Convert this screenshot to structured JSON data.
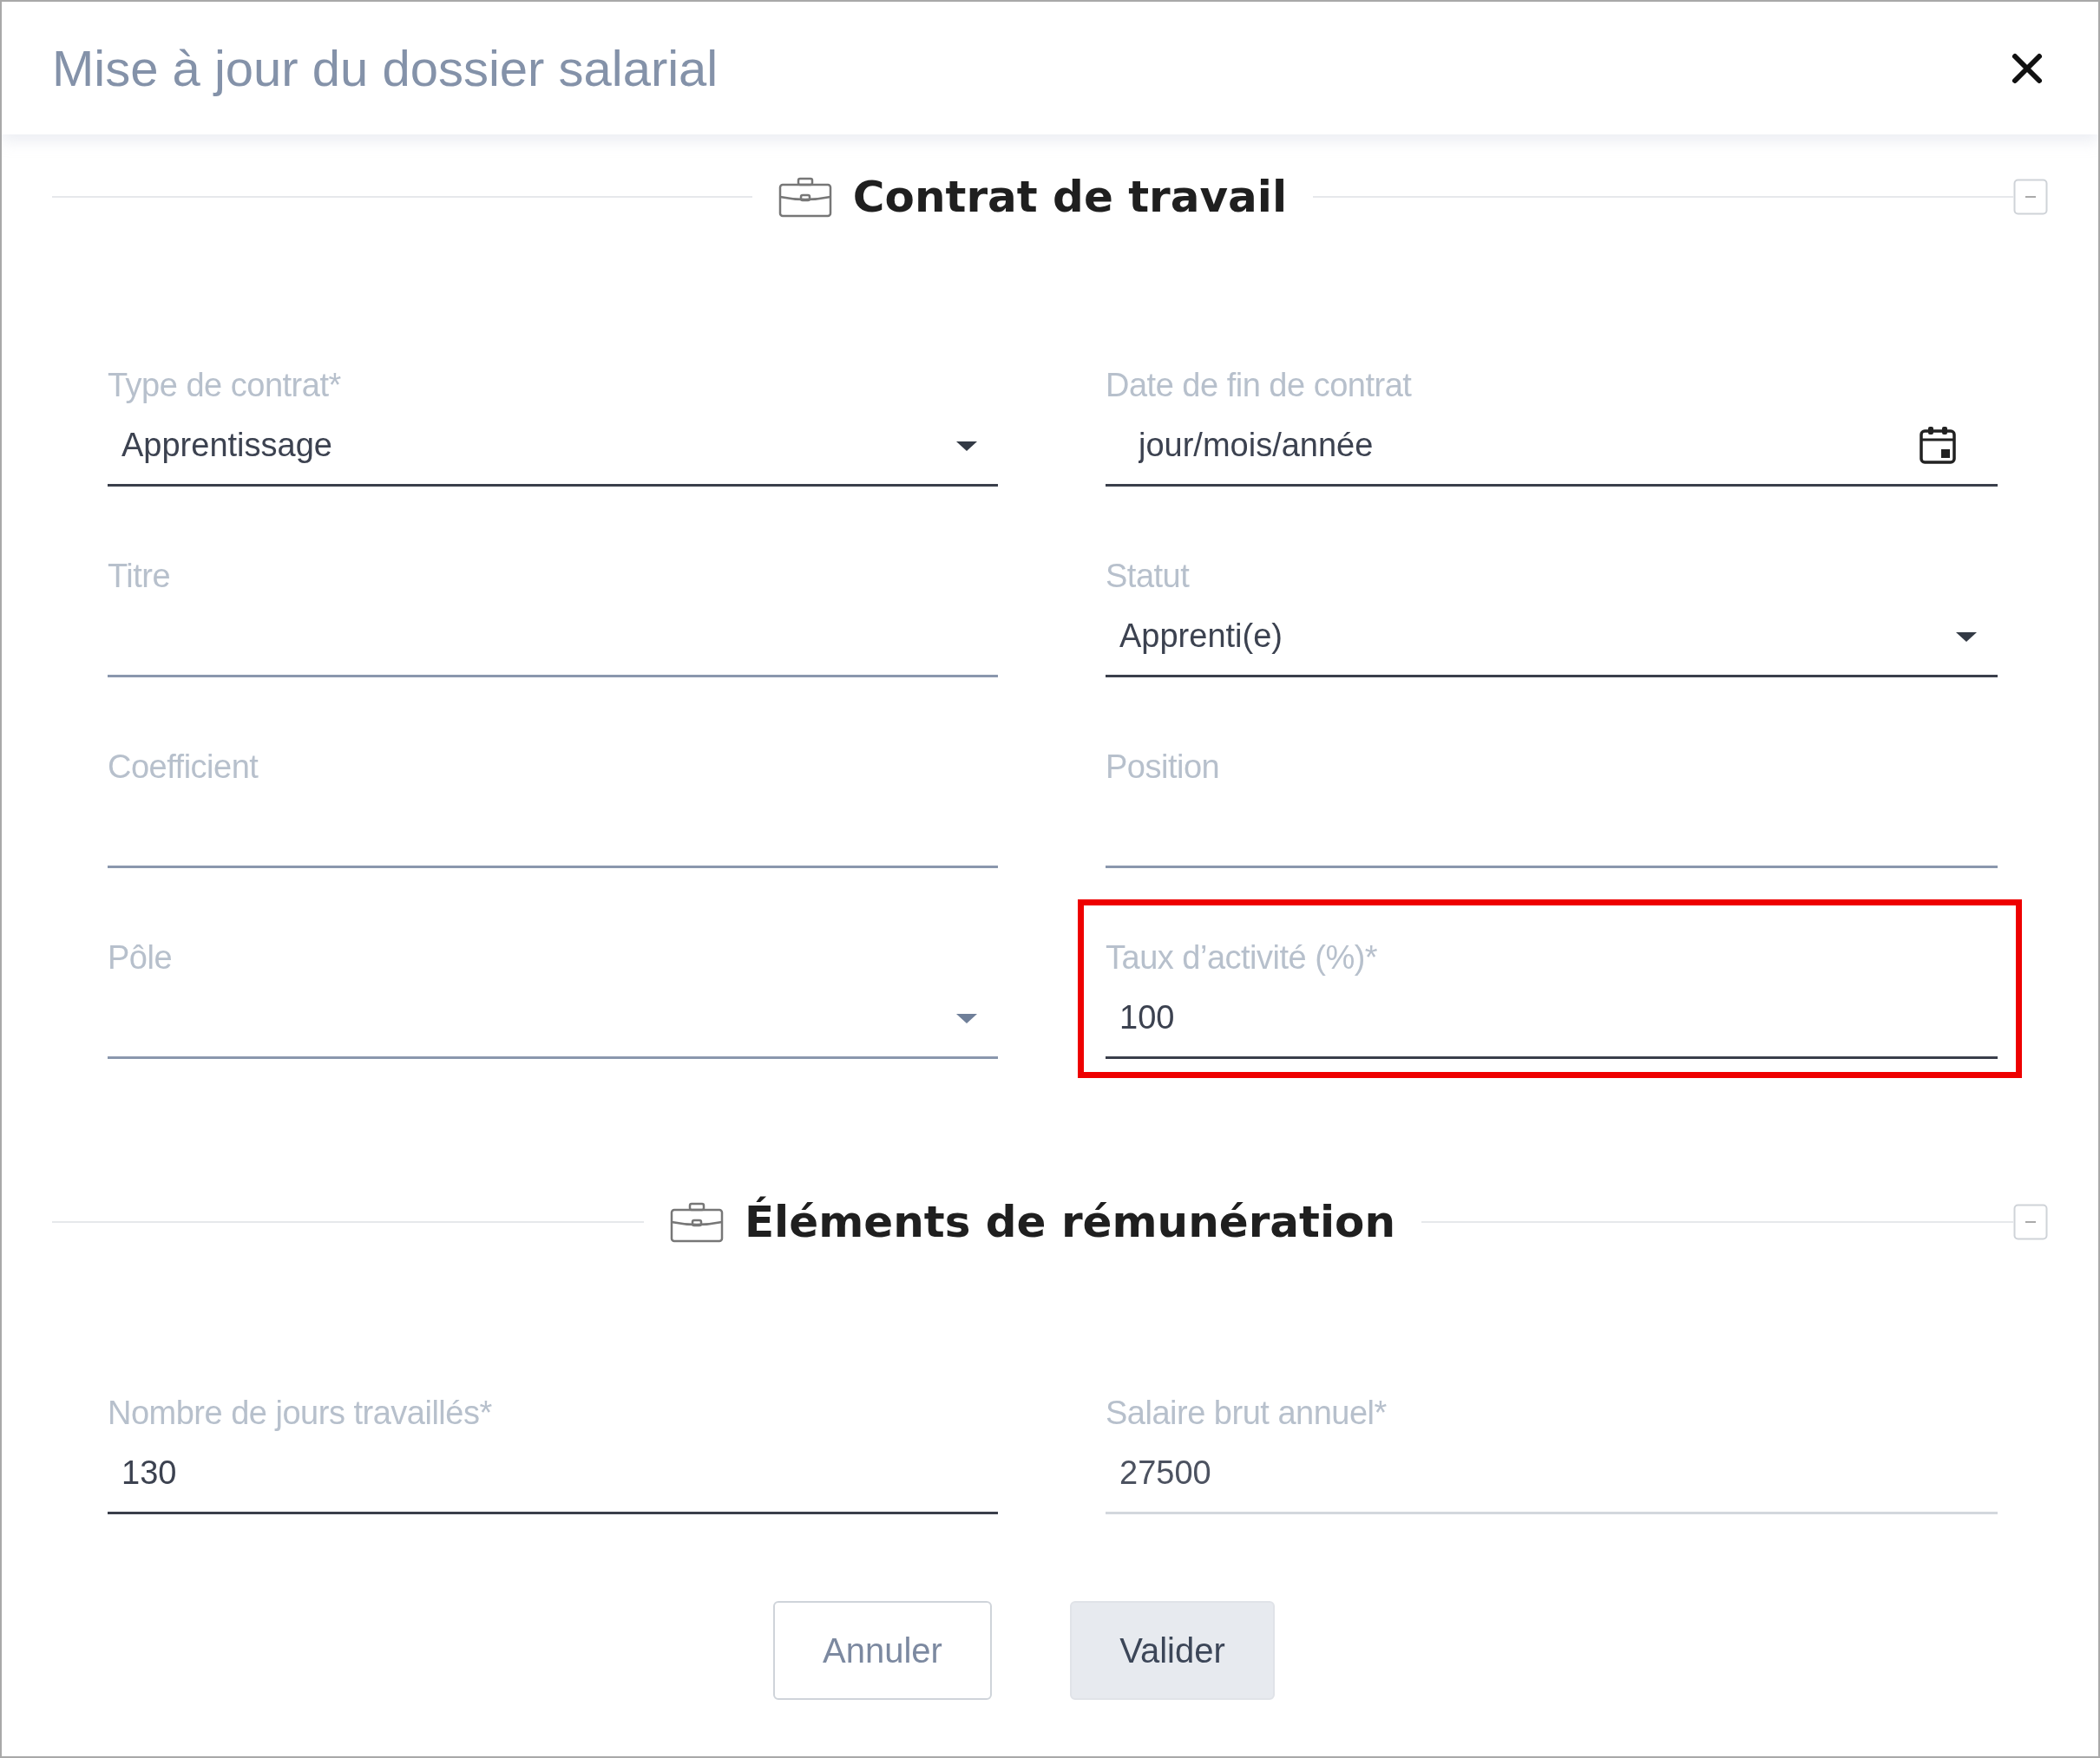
{
  "dialog": {
    "title": "Mise à jour du dossier salarial"
  },
  "sections": [
    {
      "title": "Contrat de travail",
      "expanded": true,
      "fields": [
        {
          "label": "Type de contrat*",
          "kind": "select",
          "value": "Apprentissage",
          "disabled": false,
          "highlighted": false
        },
        {
          "label": "Date de fin de contrat",
          "kind": "date",
          "placeholder": "jour/mois/année",
          "disabled": false,
          "highlighted": false
        },
        {
          "label": "Titre",
          "kind": "text",
          "disabled": false,
          "highlighted": false
        },
        {
          "label": "Statut",
          "kind": "select",
          "value": "Apprenti(e)",
          "disabled": false,
          "highlighted": false
        },
        {
          "label": "Coefficient",
          "kind": "text",
          "disabled": false,
          "highlighted": false
        },
        {
          "label": "Position",
          "kind": "text",
          "disabled": false,
          "highlighted": false
        },
        {
          "label": "Pôle",
          "kind": "select",
          "disabled": false,
          "highlighted": false
        },
        {
          "label": "Taux d’activité (%)*",
          "kind": "text",
          "value": "100",
          "disabled": false,
          "highlighted": true
        }
      ]
    },
    {
      "title": "Éléments de rémunération",
      "expanded": true,
      "fields": [
        {
          "label": "Nombre de jours travaillés*",
          "kind": "text",
          "value": "130",
          "disabled": false,
          "highlighted": false
        },
        {
          "label": "Salaire brut annuel*",
          "kind": "text",
          "value": "27500",
          "disabled": true,
          "highlighted": false
        }
      ]
    }
  ],
  "buttons": [
    {
      "label": "Annuler",
      "kind": "secondary"
    },
    {
      "label": "Valider",
      "kind": "primary"
    }
  ]
}
